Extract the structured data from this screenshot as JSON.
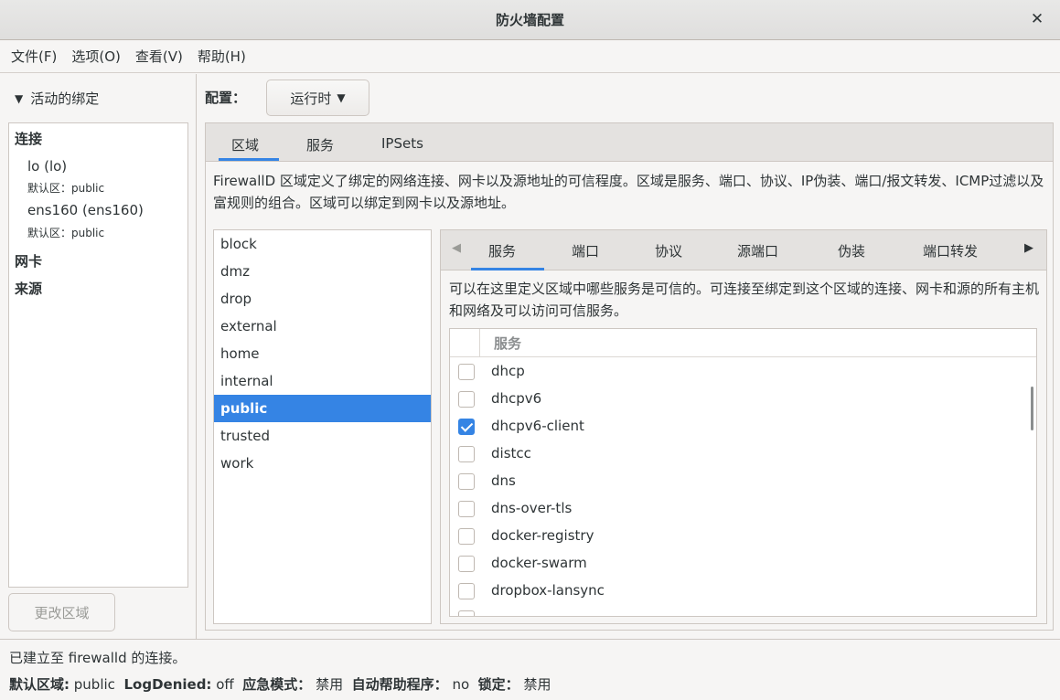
{
  "window": {
    "title": "防火墙配置"
  },
  "menu": [
    "文件(F)",
    "选项(O)",
    "查看(V)",
    "帮助(H)"
  ],
  "left": {
    "header": "活动的绑定",
    "sections": {
      "connections": "连接",
      "nics": "网卡",
      "sources": "来源"
    },
    "connections": [
      {
        "name": "lo (lo)",
        "zone": "默认区：public"
      },
      {
        "name": "ens160 (ens160)",
        "zone": "默认区：public"
      }
    ],
    "change_zone_button": "更改区域"
  },
  "config": {
    "label": "配置：",
    "value": "运行时"
  },
  "outer_tabs": [
    "区域",
    "服务",
    "IPSets"
  ],
  "zone_description": "FirewallD 区域定义了绑定的网络连接、网卡以及源地址的可信程度。区域是服务、端口、协议、IP伪装、端口/报文转发、ICMP过滤以及富规则的组合。区域可以绑定到网卡以及源地址。",
  "zones": [
    "block",
    "dmz",
    "drop",
    "external",
    "home",
    "internal",
    "public",
    "trusted",
    "work"
  ],
  "selected_zone": "public",
  "inner_tabs": [
    "服务",
    "端口",
    "协议",
    "源端口",
    "伪装",
    "端口转发"
  ],
  "services_description": "可以在这里定义区域中哪些服务是可信的。可连接至绑定到这个区域的连接、网卡和源的所有主机和网络及可以访问可信服务。",
  "services_header": "服务",
  "services": [
    {
      "name": "dhcp",
      "checked": false
    },
    {
      "name": "dhcpv6",
      "checked": false
    },
    {
      "name": "dhcpv6-client",
      "checked": true
    },
    {
      "name": "distcc",
      "checked": false
    },
    {
      "name": "dns",
      "checked": false
    },
    {
      "name": "dns-over-tls",
      "checked": false
    },
    {
      "name": "docker-registry",
      "checked": false
    },
    {
      "name": "docker-swarm",
      "checked": false
    },
    {
      "name": "dropbox-lansync",
      "checked": false
    }
  ],
  "status": {
    "connection": "已建立至 firewalld 的连接。",
    "default_zone_label": "默认区域:",
    "default_zone_value": "public",
    "logdenied_label": "LogDenied:",
    "logdenied_value": "off",
    "panic_label": "应急模式：",
    "panic_value": "禁用",
    "autohelper_label": "自动帮助程序：",
    "autohelper_value": "no",
    "lockdown_label": "锁定：",
    "lockdown_value": "禁用"
  },
  "colors": {
    "accent": "#3584e4",
    "background": "#f6f5f4"
  }
}
